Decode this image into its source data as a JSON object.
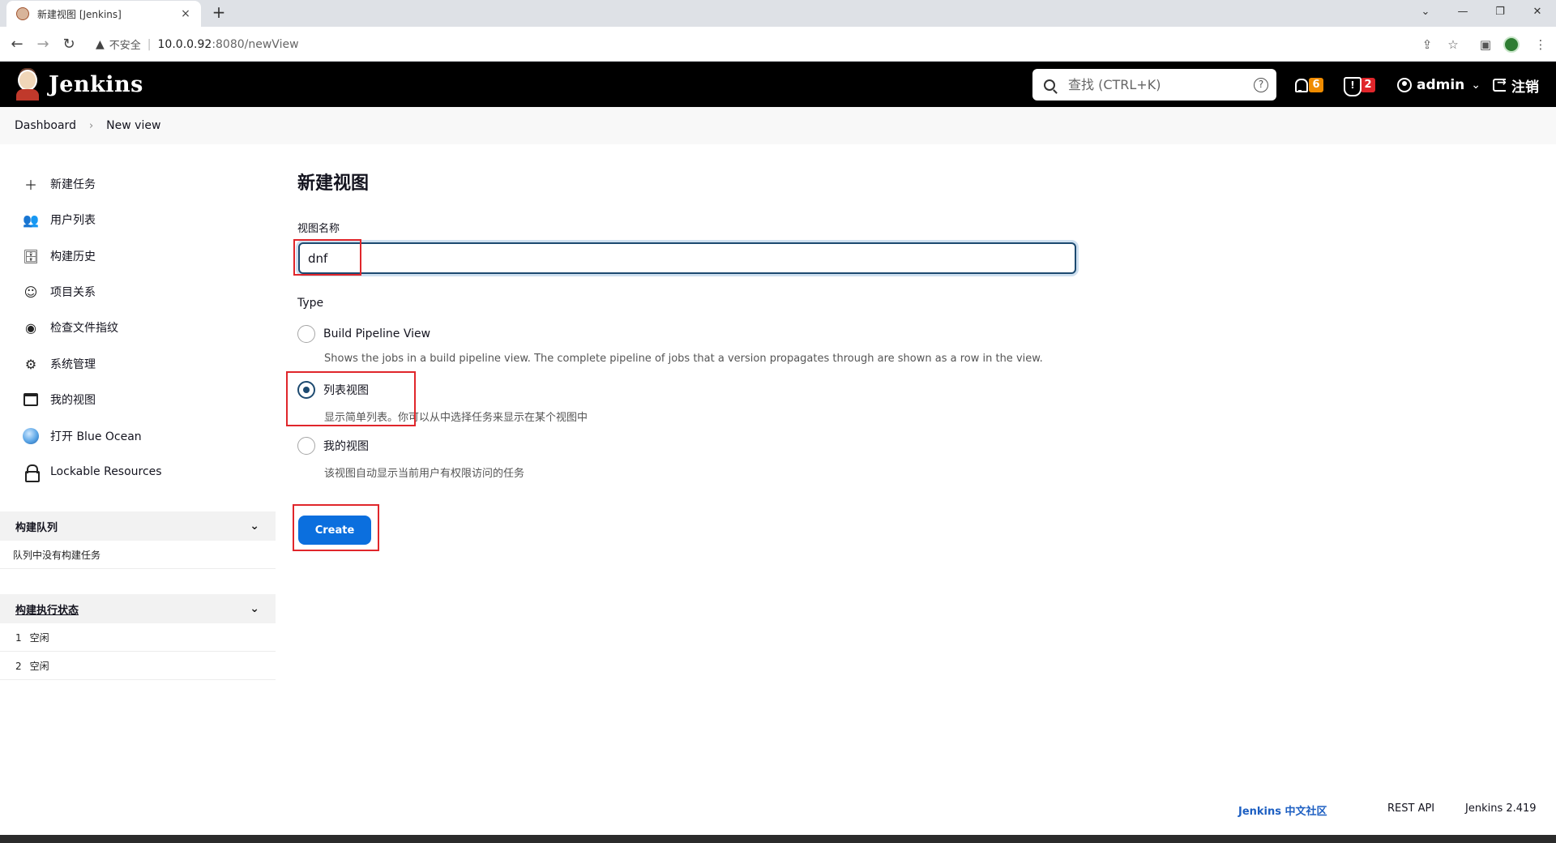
{
  "browser": {
    "tab_title": "新建视图 [Jenkins]",
    "tab_close": "×",
    "new_tab": "+",
    "window_controls": [
      "⌄",
      "—",
      "❐",
      "✕"
    ],
    "nav": {
      "back": "←",
      "forward": "→",
      "reload": "↻"
    },
    "address": {
      "warning_icon": "▲",
      "security_label": "不安全",
      "separator": "|",
      "host": "10.0.0.92",
      "path": ":8080/newView"
    },
    "toolbar_icons": {
      "share": "⇪",
      "bookmark": "☆",
      "sidepanel": "▣",
      "menu": "⋮"
    }
  },
  "header": {
    "brand": "Jenkins",
    "search": {
      "placeholder": "查找 (CTRL+K)",
      "help": "?"
    },
    "notifications_count": "6",
    "security_count": "2",
    "user": "admin",
    "user_chevron": "⌄",
    "logout": "注销",
    "badge_colors": {
      "notifications": "#f08c00",
      "security": "#e0262b"
    }
  },
  "breadcrumb": {
    "items": [
      "Dashboard",
      "New view"
    ],
    "separator": "›"
  },
  "sidebar": {
    "tasks": [
      {
        "label": "新建任务",
        "icon": "＋"
      },
      {
        "label": "用户列表",
        "icon": "👥"
      },
      {
        "label": "构建历史",
        "icon": "🗄"
      },
      {
        "label": "项目关系",
        "icon": "☺"
      },
      {
        "label": "检查文件指纹",
        "icon": "◉"
      },
      {
        "label": "系统管理",
        "icon": "⚙"
      },
      {
        "label": "我的视图",
        "icon": ""
      },
      {
        "label": "打开 Blue Ocean",
        "icon": ""
      },
      {
        "label": "Lockable Resources",
        "icon": ""
      }
    ],
    "build_queue": {
      "title": "构建队列",
      "chevron": "⌄",
      "empty_text": "队列中没有构建任务"
    },
    "executors": {
      "title": "构建执行状态",
      "chevron": "⌄",
      "rows": [
        {
          "num": "1",
          "status": "空闲"
        },
        {
          "num": "2",
          "status": "空闲"
        }
      ]
    }
  },
  "main": {
    "title": "新建视图",
    "name_label": "视图名称",
    "name_value": "dnf",
    "type_label": "Type",
    "options": [
      {
        "label": "Build Pipeline View",
        "description": "Shows the jobs in a build pipeline view. The complete pipeline of jobs that a version propagates through are shown as a row in the view.",
        "selected": false
      },
      {
        "label": "列表视图",
        "description": "显示简单列表。你可以从中选择任务来显示在某个视图中",
        "selected": true
      },
      {
        "label": "我的视图",
        "description": "该视图自动显示当前用户有权限访问的任务",
        "selected": false
      }
    ],
    "create_label": "Create",
    "highlight_color": "#e0262b"
  },
  "footer": {
    "community": "Jenkins 中文社区",
    "rest_api": "REST API",
    "version": "Jenkins 2.419"
  }
}
